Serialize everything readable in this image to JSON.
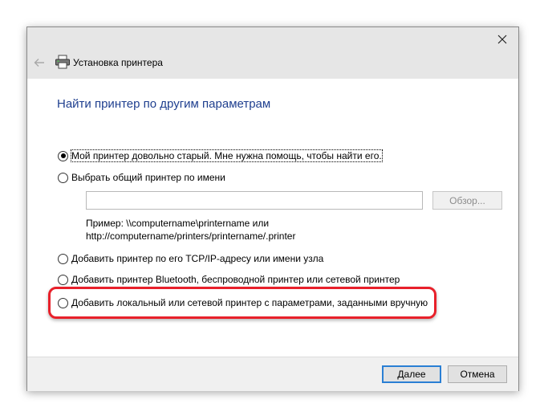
{
  "window": {
    "title": "Установка принтера",
    "heading": "Найти принтер по другим параметрам"
  },
  "options": [
    {
      "label": "Мой принтер довольно старый. Мне нужна помощь, чтобы найти его.",
      "checked": true
    },
    {
      "label": "Выбрать общий принтер по имени",
      "checked": false
    },
    {
      "label": "Добавить принтер по его TCP/IP-адресу или имени узла",
      "checked": false
    },
    {
      "label": "Добавить принтер Bluetooth, беспроводной принтер или сетевой принтер",
      "checked": false
    },
    {
      "label": "Добавить локальный или сетевой принтер с параметрами, заданными вручную",
      "checked": false
    }
  ],
  "share_name": {
    "value": "",
    "browse_label": "Обзор...",
    "example_line1": "Пример: \\\\computername\\printername или",
    "example_line2": "http://computername/printers/printername/.printer"
  },
  "footer": {
    "next_label": "Далее",
    "cancel_label": "Отмена"
  },
  "colors": {
    "heading": "#1f3f8f",
    "highlight": "#e8202a",
    "default_button_border": "#2a7fd4"
  }
}
